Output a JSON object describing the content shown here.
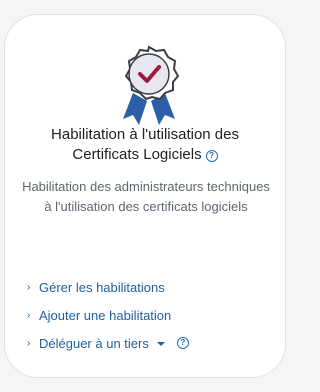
{
  "card": {
    "title_line1": "Habilitation à l'utilisation des",
    "title_line2": "Certificats Logiciels",
    "description": "Habilitation des administrateurs techniques à l'utilisation des certificats logiciels",
    "help_glyph": "?"
  },
  "links": [
    {
      "label": "Gérer les habilitations"
    },
    {
      "label": "Ajouter une habilitation"
    },
    {
      "label": "Déléguer à un tiers"
    }
  ],
  "icons": {
    "badge": "certificate-badge-icon",
    "chevron": "›"
  },
  "colors": {
    "link": "#1f5f9e",
    "badge_ribbon": "#2d5fa8",
    "check": "#9b1b3d"
  }
}
